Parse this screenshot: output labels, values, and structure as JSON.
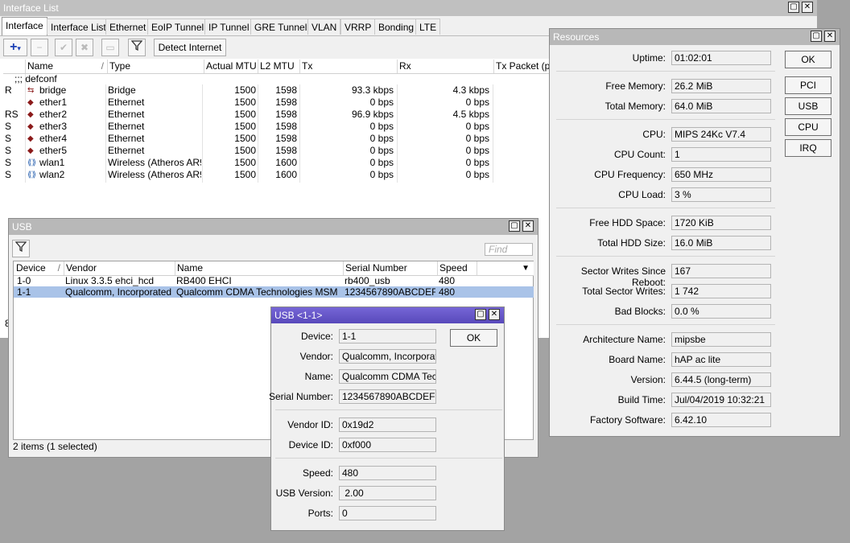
{
  "interface_window": {
    "title": "Interface List",
    "tabs": [
      "Interface",
      "Interface List",
      "Ethernet",
      "EoIP Tunnel",
      "IP Tunnel",
      "GRE Tunnel",
      "VLAN",
      "VRRP",
      "Bonding",
      "LTE"
    ],
    "detect_internet_label": "Detect Internet",
    "columns": [
      "Name",
      "Type",
      "Actual MTU",
      "L2 MTU",
      "Tx",
      "Rx",
      "Tx Packet (p/s"
    ],
    "group_label": ";;; defconf",
    "rows": [
      {
        "flag": "R",
        "name": "bridge",
        "type": "Bridge",
        "mtu": "1500",
        "l2mtu": "1598",
        "tx": "93.3 kbps",
        "rx": "4.3 kbps"
      },
      {
        "flag": "",
        "name": "ether1",
        "type": "Ethernet",
        "mtu": "1500",
        "l2mtu": "1598",
        "tx": "0 bps",
        "rx": "0 bps"
      },
      {
        "flag": "RS",
        "name": "ether2",
        "type": "Ethernet",
        "mtu": "1500",
        "l2mtu": "1598",
        "tx": "96.9 kbps",
        "rx": "4.5 kbps"
      },
      {
        "flag": "S",
        "name": "ether3",
        "type": "Ethernet",
        "mtu": "1500",
        "l2mtu": "1598",
        "tx": "0 bps",
        "rx": "0 bps"
      },
      {
        "flag": "S",
        "name": "ether4",
        "type": "Ethernet",
        "mtu": "1500",
        "l2mtu": "1598",
        "tx": "0 bps",
        "rx": "0 bps"
      },
      {
        "flag": "S",
        "name": "ether5",
        "type": "Ethernet",
        "mtu": "1500",
        "l2mtu": "1598",
        "tx": "0 bps",
        "rx": "0 bps"
      },
      {
        "flag": "S",
        "name": "wlan1",
        "type": "Wireless (Atheros AR9...",
        "mtu": "1500",
        "l2mtu": "1600",
        "tx": "0 bps",
        "rx": "0 bps"
      },
      {
        "flag": "S",
        "name": "wlan2",
        "type": "Wireless (Atheros AR9...",
        "mtu": "1500",
        "l2mtu": "1600",
        "tx": "0 bps",
        "rx": "0 bps"
      }
    ],
    "partial_status": "8"
  },
  "resources_window": {
    "title": "Resources",
    "fields": [
      {
        "label": "Uptime:",
        "value": "01:02:01"
      },
      {
        "label": "Free Memory:",
        "value": "26.2 MiB"
      },
      {
        "label": "Total Memory:",
        "value": "64.0 MiB"
      },
      {
        "label": "CPU:",
        "value": "MIPS 24Kc V7.4"
      },
      {
        "label": "CPU Count:",
        "value": "1"
      },
      {
        "label": "CPU Frequency:",
        "value": "650 MHz"
      },
      {
        "label": "CPU Load:",
        "value": "3 %"
      },
      {
        "label": "Free HDD Space:",
        "value": "1720 KiB"
      },
      {
        "label": "Total HDD Size:",
        "value": "16.0 MiB"
      },
      {
        "label": "Sector Writes Since Reboot:",
        "value": "167"
      },
      {
        "label": "Total Sector Writes:",
        "value": "1 742"
      },
      {
        "label": "Bad Blocks:",
        "value": "0.0 %"
      },
      {
        "label": "Architecture Name:",
        "value": "mipsbe"
      },
      {
        "label": "Board Name:",
        "value": "hAP ac lite"
      },
      {
        "label": "Version:",
        "value": "6.44.5 (long-term)"
      },
      {
        "label": "Build Time:",
        "value": "Jul/04/2019 10:32:21"
      },
      {
        "label": "Factory Software:",
        "value": "6.42.10"
      }
    ],
    "buttons": [
      "OK",
      "PCI",
      "USB",
      "CPU",
      "IRQ"
    ]
  },
  "usb_window": {
    "title": "USB",
    "find_placeholder": "Find",
    "columns": [
      "Device",
      "Vendor",
      "Name",
      "Serial Number",
      "Speed"
    ],
    "rows": [
      {
        "device": "1-0",
        "vendor": "Linux 3.3.5 ehci_hcd",
        "name": "RB400 EHCI",
        "serial": "rb400_usb",
        "speed": "480",
        "selected": false
      },
      {
        "device": "1-1",
        "vendor": "Qualcomm, Incorporated",
        "name": "Qualcomm CDMA Technologies MSM",
        "serial": "1234567890ABCDEF",
        "speed": "480",
        "selected": true
      }
    ],
    "status": "2 items (1 selected)"
  },
  "usb_detail_window": {
    "title": "USB <1-1>",
    "ok_label": "OK",
    "fields": [
      {
        "label": "Device:",
        "value": "1-1"
      },
      {
        "label": "Vendor:",
        "value": "Qualcomm, Incorporated"
      },
      {
        "label": "Name:",
        "value": "Qualcomm CDMA Tec..."
      },
      {
        "label": "Serial Number:",
        "value": "1234567890ABCDEF"
      },
      {
        "label": "Vendor ID:",
        "value": "0x19d2"
      },
      {
        "label": "Device ID:",
        "value": "0xf000"
      },
      {
        "label": "Speed:",
        "value": "480"
      },
      {
        "label": "USB Version:",
        "value": " 2.00"
      },
      {
        "label": "Ports:",
        "value": "0"
      }
    ]
  },
  "colors": {
    "selected_row": "#a9c3e8",
    "active_title": "#6a5acd",
    "desktop": "#a3a3a3"
  }
}
